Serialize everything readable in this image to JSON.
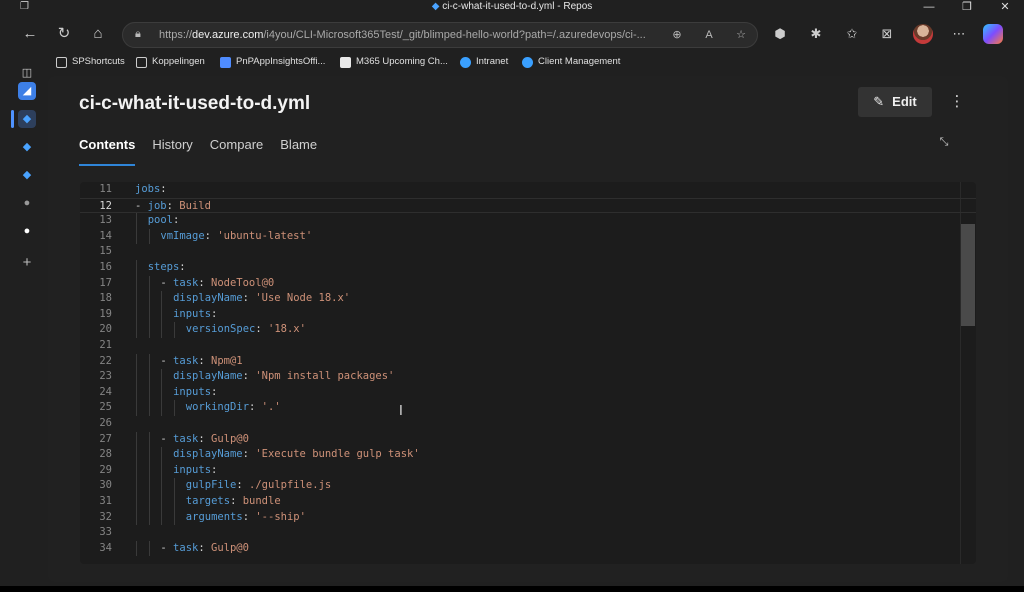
{
  "window": {
    "title": "ci-c-what-it-used-to-d.yml - Repos"
  },
  "address": {
    "url_prefix": "https://",
    "url_domain": "dev.azure.com",
    "url_rest": "/i4you/CLI-Microsoft365Test/_git/blimped-hello-world?path=/.azuredevops/ci-..."
  },
  "favorites": [
    {
      "label": "SPShortcuts",
      "color": "#e8e8e8"
    },
    {
      "label": "Koppelingen",
      "color": "#e8e8e8"
    },
    {
      "label": "PnPAppInsightsOffi...",
      "color": "#4f8cff"
    },
    {
      "label": "M365 Upcoming Ch...",
      "color": "#e8e8e8"
    },
    {
      "label": "Intranet",
      "color": "#3aa0ff"
    },
    {
      "label": "Client Management",
      "color": "#3aa0ff"
    }
  ],
  "file": {
    "title": "ci-c-what-it-used-to-d.yml",
    "edit_label": "Edit"
  },
  "tabs": [
    {
      "label": "Contents",
      "active": true
    },
    {
      "label": "History",
      "active": false
    },
    {
      "label": "Compare",
      "active": false
    },
    {
      "label": "Blame",
      "active": false
    }
  ],
  "editor": {
    "current_line": 12,
    "lines": [
      {
        "n": 11,
        "indent": 0,
        "tokens": [
          [
            "k",
            "jobs"
          ],
          [
            "p",
            ":"
          ]
        ]
      },
      {
        "n": 12,
        "indent": 0,
        "tokens": [
          [
            "p",
            "- "
          ],
          [
            "k",
            "job"
          ],
          [
            "p",
            ": "
          ],
          [
            "v",
            "Build"
          ]
        ]
      },
      {
        "n": 13,
        "indent": 1,
        "tokens": [
          [
            "k",
            "pool"
          ],
          [
            "p",
            ":"
          ]
        ]
      },
      {
        "n": 14,
        "indent": 2,
        "tokens": [
          [
            "k",
            "vmImage"
          ],
          [
            "p",
            ": "
          ],
          [
            "s",
            "'ubuntu-latest'"
          ]
        ]
      },
      {
        "n": 15,
        "indent": 0,
        "tokens": []
      },
      {
        "n": 16,
        "indent": 1,
        "tokens": [
          [
            "k",
            "steps"
          ],
          [
            "p",
            ":"
          ]
        ]
      },
      {
        "n": 17,
        "indent": 2,
        "tokens": [
          [
            "p",
            "- "
          ],
          [
            "k",
            "task"
          ],
          [
            "p",
            ": "
          ],
          [
            "v",
            "NodeTool@0"
          ]
        ]
      },
      {
        "n": 18,
        "indent": 3,
        "tokens": [
          [
            "k",
            "displayName"
          ],
          [
            "p",
            ": "
          ],
          [
            "s",
            "'Use Node 18.x'"
          ]
        ]
      },
      {
        "n": 19,
        "indent": 3,
        "tokens": [
          [
            "k",
            "inputs"
          ],
          [
            "p",
            ":"
          ]
        ]
      },
      {
        "n": 20,
        "indent": 4,
        "tokens": [
          [
            "k",
            "versionSpec"
          ],
          [
            "p",
            ": "
          ],
          [
            "s",
            "'18.x'"
          ]
        ]
      },
      {
        "n": 21,
        "indent": 0,
        "tokens": []
      },
      {
        "n": 22,
        "indent": 2,
        "tokens": [
          [
            "p",
            "- "
          ],
          [
            "k",
            "task"
          ],
          [
            "p",
            ": "
          ],
          [
            "v",
            "Npm@1"
          ]
        ]
      },
      {
        "n": 23,
        "indent": 3,
        "tokens": [
          [
            "k",
            "displayName"
          ],
          [
            "p",
            ": "
          ],
          [
            "s",
            "'Npm install packages'"
          ]
        ]
      },
      {
        "n": 24,
        "indent": 3,
        "tokens": [
          [
            "k",
            "inputs"
          ],
          [
            "p",
            ":"
          ]
        ]
      },
      {
        "n": 25,
        "indent": 4,
        "tokens": [
          [
            "k",
            "workingDir"
          ],
          [
            "p",
            ": "
          ],
          [
            "s",
            "'.'"
          ]
        ]
      },
      {
        "n": 26,
        "indent": 0,
        "tokens": []
      },
      {
        "n": 27,
        "indent": 2,
        "tokens": [
          [
            "p",
            "- "
          ],
          [
            "k",
            "task"
          ],
          [
            "p",
            ": "
          ],
          [
            "v",
            "Gulp@0"
          ]
        ]
      },
      {
        "n": 28,
        "indent": 3,
        "tokens": [
          [
            "k",
            "displayName"
          ],
          [
            "p",
            ": "
          ],
          [
            "s",
            "'Execute bundle gulp task'"
          ]
        ]
      },
      {
        "n": 29,
        "indent": 3,
        "tokens": [
          [
            "k",
            "inputs"
          ],
          [
            "p",
            ":"
          ]
        ]
      },
      {
        "n": 30,
        "indent": 4,
        "tokens": [
          [
            "k",
            "gulpFile"
          ],
          [
            "p",
            ": "
          ],
          [
            "v",
            "./gulpfile.js"
          ]
        ]
      },
      {
        "n": 31,
        "indent": 4,
        "tokens": [
          [
            "k",
            "targets"
          ],
          [
            "p",
            ": "
          ],
          [
            "v",
            "bundle"
          ]
        ]
      },
      {
        "n": 32,
        "indent": 4,
        "tokens": [
          [
            "k",
            "arguments"
          ],
          [
            "p",
            ": "
          ],
          [
            "s",
            "'--ship'"
          ]
        ]
      },
      {
        "n": 33,
        "indent": 0,
        "tokens": []
      },
      {
        "n": 34,
        "indent": 2,
        "tokens": [
          [
            "p",
            "- "
          ],
          [
            "k",
            "task"
          ],
          [
            "p",
            ": "
          ],
          [
            "v",
            "Gulp@0"
          ]
        ]
      }
    ]
  }
}
